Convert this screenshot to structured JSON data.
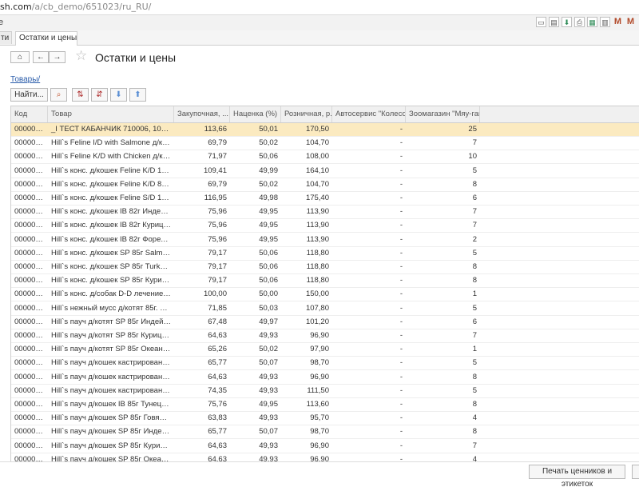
{
  "browser": {
    "url_host": "sh.com",
    "url_path": "/a/cb_demo/651023/ru_RU/"
  },
  "app": {
    "left_char": "е",
    "tabs": [
      {
        "label": "ти и цены"
      },
      {
        "label": "Остатки и цены"
      }
    ],
    "toolbar_icons": [
      "save-icon",
      "print-icon",
      "download-icon",
      "printer-icon",
      "spreadsheet-icon",
      "table-icon",
      "M",
      "M"
    ]
  },
  "form": {
    "title": "Остатки и цены",
    "breadcrumb": "Товары/",
    "find_label": "Найти...",
    "print_label": "Печать ценников и этикеток"
  },
  "colors": {
    "selected_row": "#fbeac0",
    "link": "#2a5caa"
  },
  "table": {
    "headers": {
      "code": "Код",
      "name": "Товар",
      "buy": "Закупочная, ...",
      "markup": "Наценка (%)",
      "retail": "Розничная, р...",
      "auto": "Автосервис \"Колесо\"",
      "zoo": "Зоомагазин \"Мяу-гав\""
    },
    "rows": [
      {
        "code": "000000...",
        "name": "_I ТЕСТ КАБАНЧИК 710006, 100мм , шт",
        "buy": "113,66",
        "markup": "50,01",
        "retail": "170,50",
        "auto": "-",
        "zoo": "25"
      },
      {
        "code": "000000...",
        "name": "Hill`s Feline I/D with Salmone д/кошек ...",
        "buy": "69,79",
        "markup": "50,02",
        "retail": "104,70",
        "auto": "-",
        "zoo": "7"
      },
      {
        "code": "000000...",
        "name": "Hill`s Feline K/D with Chicken д/кошек ...",
        "buy": "71,97",
        "markup": "50,06",
        "retail": "108,00",
        "auto": "-",
        "zoo": "10"
      },
      {
        "code": "000000...",
        "name": "Hill`s конс. д/кошек Feline K/D 156г ле...",
        "buy": "109,41",
        "markup": "49,99",
        "retail": "164,10",
        "auto": "-",
        "zoo": "5"
      },
      {
        "code": "000000...",
        "name": "Hill`s конс. д/кошек Feline K/D 85г под...",
        "buy": "69,79",
        "markup": "50,02",
        "retail": "104,70",
        "auto": "-",
        "zoo": "8"
      },
      {
        "code": "000000...",
        "name": "Hill`s конс. д/кошек Feline S/D 156г ле...",
        "buy": "116,95",
        "markup": "49,98",
        "retail": "175,40",
        "auto": "-",
        "zoo": "6"
      },
      {
        "code": "000000...",
        "name": "Hill`s конс. д/кошек IB 82г Индейка, шт",
        "buy": "75,96",
        "markup": "49,95",
        "retail": "113,90",
        "auto": "-",
        "zoo": "7"
      },
      {
        "code": "000000...",
        "name": "Hill`s конс. д/кошек IB 82г Курица, шт",
        "buy": "75,96",
        "markup": "49,95",
        "retail": "113,90",
        "auto": "-",
        "zoo": "7"
      },
      {
        "code": "000000...",
        "name": "Hill`s конс. д/кошек IB 82г Форель, шт",
        "buy": "75,96",
        "markup": "49,95",
        "retail": "113,90",
        "auto": "-",
        "zoo": "2"
      },
      {
        "code": "000000...",
        "name": "Hill`s конс. д/кошек SP 85г Salmon (Ло...",
        "buy": "79,17",
        "markup": "50,06",
        "retail": "118,80",
        "auto": "-",
        "zoo": "5"
      },
      {
        "code": "000000...",
        "name": "Hill`s конс. д/кошек SP 85г Turkey (Ин...",
        "buy": "79,17",
        "markup": "50,06",
        "retail": "118,80",
        "auto": "-",
        "zoo": "8"
      },
      {
        "code": "000000...",
        "name": "Hill`s конс. д/кошек SP 85г Курица и П...",
        "buy": "79,17",
        "markup": "50,06",
        "retail": "118,80",
        "auto": "-",
        "zoo": "8"
      },
      {
        "code": "000000...",
        "name": "Hill`s конс. д/собак D-D лечение пище...",
        "buy": "100,00",
        "markup": "50,00",
        "retail": "150,00",
        "auto": "-",
        "zoo": "1"
      },
      {
        "code": "000000...",
        "name": "Hill`s нежный мусс д/котят 85г. Курица...",
        "buy": "71,85",
        "markup": "50,03",
        "retail": "107,80",
        "auto": "-",
        "zoo": "5"
      },
      {
        "code": "000000...",
        "name": "Hill`s пауч д/котят SP 85г Индейка, шт",
        "buy": "67,48",
        "markup": "49,97",
        "retail": "101,20",
        "auto": "-",
        "zoo": "6"
      },
      {
        "code": "000000...",
        "name": "Hill`s пауч д/котят SP 85г Курица, шт",
        "buy": "64,63",
        "markup": "49,93",
        "retail": "96,90",
        "auto": "-",
        "zoo": "7"
      },
      {
        "code": "000000...",
        "name": "Hill`s пауч д/котят SP 85г Океаническ...",
        "buy": "65,26",
        "markup": "50,02",
        "retail": "97,90",
        "auto": "-",
        "zoo": "1"
      },
      {
        "code": "000000...",
        "name": "Hill`s пауч д/кошек  кастрированых S...",
        "buy": "65,77",
        "markup": "50,07",
        "retail": "98,70",
        "auto": "-",
        "zoo": "5"
      },
      {
        "code": "000000...",
        "name": "Hill`s пауч д/кошек  кастрированых S...",
        "buy": "64,63",
        "markup": "49,93",
        "retail": "96,90",
        "auto": "-",
        "zoo": "8"
      },
      {
        "code": "000000...",
        "name": "Hill`s пауч д/кошек  кастрированых S...",
        "buy": "74,35",
        "markup": "49,93",
        "retail": "111,50",
        "auto": "-",
        "zoo": "5"
      },
      {
        "code": "000000...",
        "name": "Hill`s пауч д/кошек IB  85г Тунец, шт",
        "buy": "75,76",
        "markup": "49,95",
        "retail": "113,60",
        "auto": "-",
        "zoo": "8"
      },
      {
        "code": "000000...",
        "name": "Hill`s пауч д/кошек SP 85г Говядина, шт",
        "buy": "63,83",
        "markup": "49,93",
        "retail": "95,70",
        "auto": "-",
        "zoo": "4"
      },
      {
        "code": "000000...",
        "name": "Hill`s пауч д/кошек SP 85г Индейка, шт",
        "buy": "65,77",
        "markup": "50,07",
        "retail": "98,70",
        "auto": "-",
        "zoo": "8"
      },
      {
        "code": "000000...",
        "name": "Hill`s пауч д/кошек SP 85г Курица, шт",
        "buy": "64,63",
        "markup": "49,93",
        "retail": "96,90",
        "auto": "-",
        "zoo": "7"
      },
      {
        "code": "000000...",
        "name": "Hill`s пауч д/кошек SP 85г Океаническ...",
        "buy": "64,63",
        "markup": "49,93",
        "retail": "96,90",
        "auto": "-",
        "zoo": "4"
      }
    ]
  }
}
